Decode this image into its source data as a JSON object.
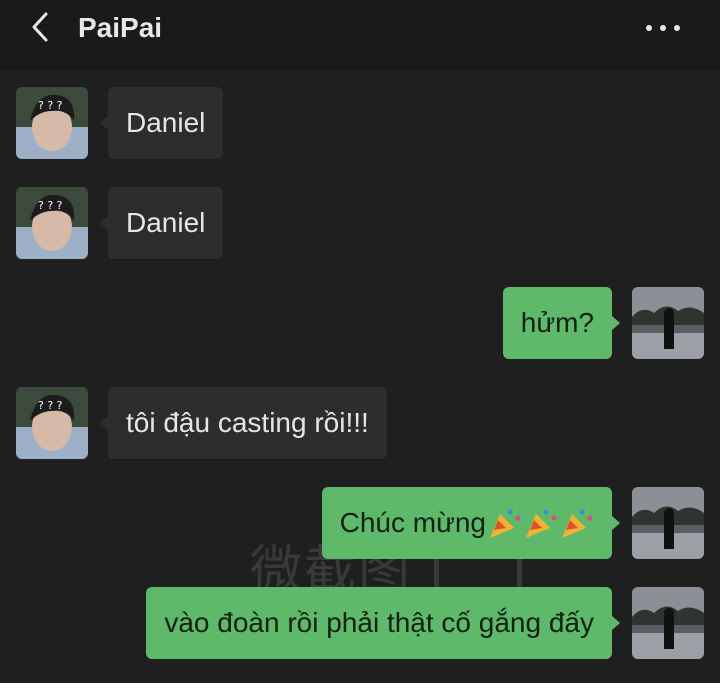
{
  "header": {
    "title": "PaiPai",
    "back_icon": "chevron-left-icon",
    "more_icon": "more-dots-icon"
  },
  "watermark": {
    "text": "微截图"
  },
  "colors": {
    "background": "#1f1f1f",
    "incoming_bubble": "#2d2d2d",
    "outgoing_bubble": "#5fb96a"
  },
  "messages": [
    {
      "side": "left",
      "text": "Daniel"
    },
    {
      "side": "left",
      "text": "Daniel"
    },
    {
      "side": "right",
      "text": "hửm?"
    },
    {
      "side": "left",
      "text": "tôi đậu casting rồi!!!"
    },
    {
      "side": "right",
      "text": "Chúc mừng",
      "emoji": [
        "party-popper-icon",
        "party-popper-icon",
        "party-popper-icon"
      ]
    },
    {
      "side": "right",
      "text": "vào đoàn rồi phải thật cố gắng đấy"
    }
  ]
}
